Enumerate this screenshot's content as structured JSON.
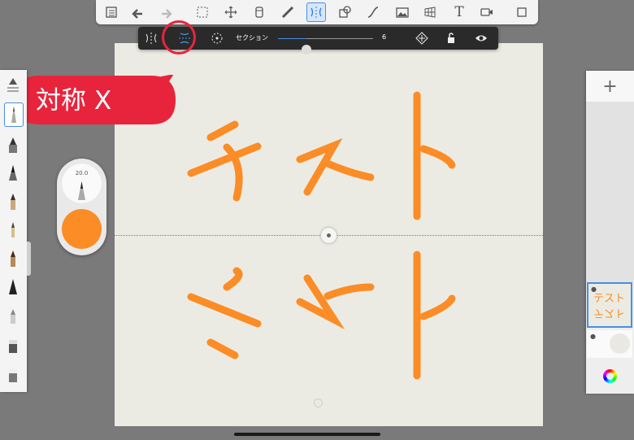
{
  "toolbar": {
    "icons": [
      "list-icon",
      "undo-icon",
      "redo-icon",
      "selection-icon",
      "transform-icon",
      "ruler-icon",
      "guides-icon",
      "symmetry-icon",
      "shapes-icon",
      "curve-icon",
      "image-import-icon",
      "perspective-icon",
      "text-icon",
      "video-icon",
      "fullscreen-icon"
    ],
    "text_label": "T",
    "active_tool": "symmetry-icon"
  },
  "symmetry_bar": {
    "section_label": "セクション",
    "section_value": "6",
    "section_fraction": 0.3,
    "modes": [
      "symmetry-y-icon",
      "symmetry-x-icon",
      "radial-symmetry-icon"
    ],
    "active_mode": "symmetry-x-icon"
  },
  "callout": {
    "text": "対称 X",
    "color": "#e8243c"
  },
  "brush_puck": {
    "size": "20.0",
    "color": "#fb8c26"
  },
  "layers": {
    "add_label": "+",
    "thumbnail_text": "テスト"
  },
  "canvas": {
    "stroke_color": "#fb8c26",
    "background": "#ebebe3"
  }
}
